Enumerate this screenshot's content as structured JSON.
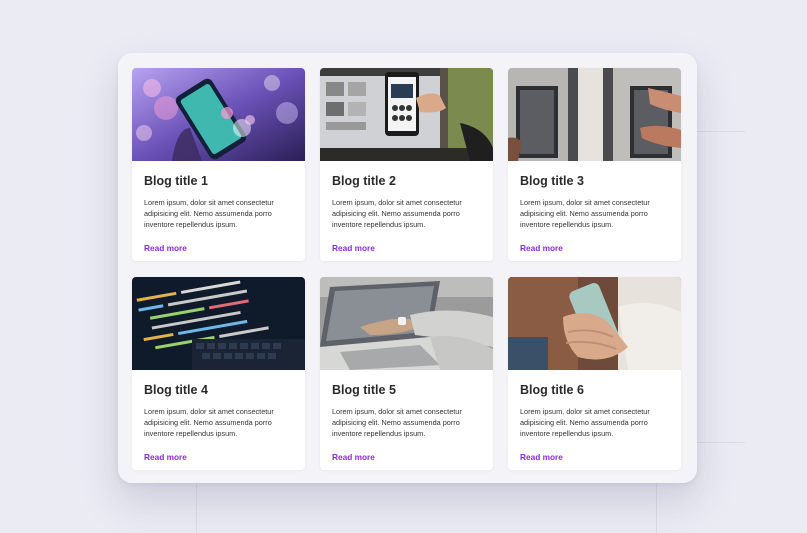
{
  "colors": {
    "background": "#ebebf4",
    "panel": "#f4f4f8",
    "card": "#ffffff",
    "link": "#8a2be2",
    "title": "#2b2b2b"
  },
  "cards": [
    {
      "title": "Blog title 1",
      "text": "Lorem ipsum, dolor sit amet consectetur adipisicing elit. Nemo assumenda porro inventore repellendus ipsum.",
      "link": "Read more",
      "image": "smartphone-bokeh-photo"
    },
    {
      "title": "Blog title 2",
      "text": "Lorem ipsum, dolor sit amet consectetur adipisicing elit. Nemo assumenda porro inventore repellendus ipsum.",
      "link": "Read more",
      "image": "phone-and-laptop-photo"
    },
    {
      "title": "Blog title 3",
      "text": "Lorem ipsum, dolor sit amet consectetur adipisicing elit. Nemo assumenda porro inventore repellendus ipsum.",
      "link": "Read more",
      "image": "laptop-keyboards-photo"
    },
    {
      "title": "Blog title 4",
      "text": "Lorem ipsum, dolor sit amet consectetur adipisicing elit. Nemo assumenda porro inventore repellendus ipsum.",
      "link": "Read more",
      "image": "code-on-screen-photo"
    },
    {
      "title": "Blog title 5",
      "text": "Lorem ipsum, dolor sit amet consectetur adipisicing elit. Nemo assumenda porro inventore repellendus ipsum.",
      "link": "Read more",
      "image": "laptop-pointing-photo"
    },
    {
      "title": "Blog title 6",
      "text": "Lorem ipsum, dolor sit amet consectetur adipisicing elit. Nemo assumenda porro inventore repellendus ipsum.",
      "link": "Read more",
      "image": "hand-holding-phone-photo"
    }
  ]
}
